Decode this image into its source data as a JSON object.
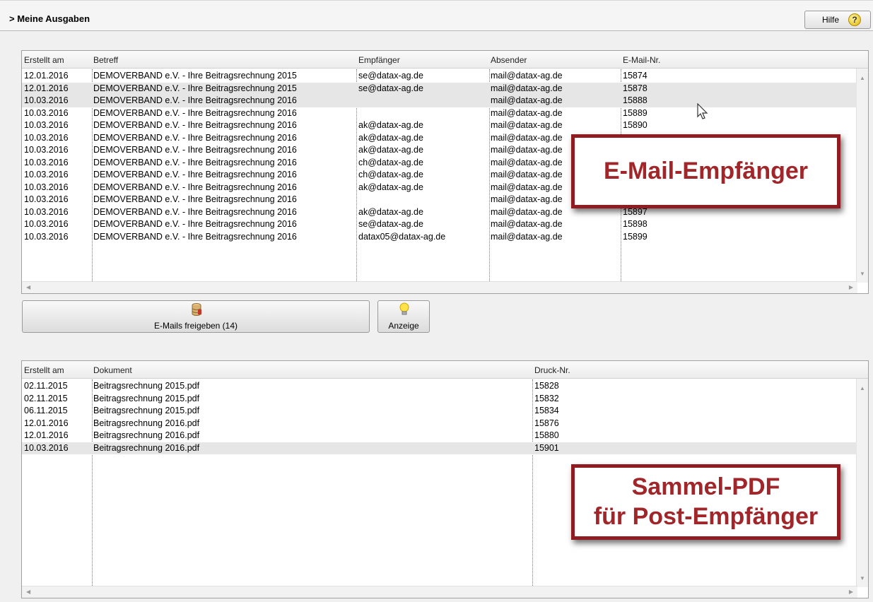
{
  "header": {
    "title": "> Meine Ausgaben",
    "help_label": "Hilfe",
    "help_icon": "question-icon"
  },
  "email_grid": {
    "columns": [
      "Erstellt am",
      "Betreff",
      "Empfänger",
      "Absender",
      "E-Mail-Nr."
    ],
    "rows": [
      [
        "12.01.2016",
        "DEMOVERBAND e.V. - Ihre Beitragsrechnung 2015",
        "se@datax-ag.de",
        "mail@datax-ag.de",
        "15874"
      ],
      [
        "12.01.2016",
        "DEMOVERBAND e.V. - Ihre Beitragsrechnung 2015",
        "se@datax-ag.de",
        "mail@datax-ag.de",
        "15878"
      ],
      [
        "10.03.2016",
        "DEMOVERBAND e.V. - Ihre Beitragsrechnung 2016",
        "",
        "mail@datax-ag.de",
        "15888"
      ],
      [
        "10.03.2016",
        "DEMOVERBAND e.V. - Ihre Beitragsrechnung 2016",
        "",
        "mail@datax-ag.de",
        "15889"
      ],
      [
        "10.03.2016",
        "DEMOVERBAND e.V. - Ihre Beitragsrechnung 2016",
        "ak@datax-ag.de",
        "mail@datax-ag.de",
        "15890"
      ],
      [
        "10.03.2016",
        "DEMOVERBAND e.V. - Ihre Beitragsrechnung 2016",
        "ak@datax-ag.de",
        "mail@datax-ag.de",
        ""
      ],
      [
        "10.03.2016",
        "DEMOVERBAND e.V. - Ihre Beitragsrechnung 2016",
        "ak@datax-ag.de",
        "mail@datax-ag.de",
        ""
      ],
      [
        "10.03.2016",
        "DEMOVERBAND e.V. - Ihre Beitragsrechnung 2016",
        "ch@datax-ag.de",
        "mail@datax-ag.de",
        ""
      ],
      [
        "10.03.2016",
        "DEMOVERBAND e.V. - Ihre Beitragsrechnung 2016",
        "ch@datax-ag.de",
        "mail@datax-ag.de",
        ""
      ],
      [
        "10.03.2016",
        "DEMOVERBAND e.V. - Ihre Beitragsrechnung 2016",
        "ak@datax-ag.de",
        "mail@datax-ag.de",
        ""
      ],
      [
        "10.03.2016",
        "DEMOVERBAND e.V. - Ihre Beitragsrechnung 2016",
        "",
        "mail@datax-ag.de",
        ""
      ],
      [
        "10.03.2016",
        "DEMOVERBAND e.V. - Ihre Beitragsrechnung 2016",
        "ak@datax-ag.de",
        "mail@datax-ag.de",
        "15897"
      ],
      [
        "10.03.2016",
        "DEMOVERBAND e.V. - Ihre Beitragsrechnung 2016",
        "se@datax-ag.de",
        "mail@datax-ag.de",
        "15898"
      ],
      [
        "10.03.2016",
        "DEMOVERBAND e.V. - Ihre Beitragsrechnung 2016",
        "datax05@datax-ag.de",
        "mail@datax-ag.de",
        "15899"
      ]
    ],
    "selected_rows": [
      1,
      2
    ]
  },
  "buttons": {
    "release_label": "E-Mails freigeben (14)",
    "release_icon": "database-icon",
    "show_label": "Anzeige",
    "show_icon": "lightbulb-icon"
  },
  "print_grid": {
    "columns": [
      "Erstellt am",
      "Dokument",
      "Druck-Nr."
    ],
    "rows": [
      [
        "02.11.2015",
        "Beitragsrechnung 2015.pdf",
        "15828"
      ],
      [
        "02.11.2015",
        "Beitragsrechnung 2015.pdf",
        "15832"
      ],
      [
        "06.11.2015",
        "Beitragsrechnung 2015.pdf",
        "15834"
      ],
      [
        "12.01.2016",
        "Beitragsrechnung 2016.pdf",
        "15876"
      ],
      [
        "12.01.2016",
        "Beitragsrechnung 2016.pdf",
        "15880"
      ],
      [
        "10.03.2016",
        "Beitragsrechnung 2016.pdf",
        "15901"
      ]
    ],
    "selected_rows": [
      5
    ]
  },
  "callouts": {
    "email": "E-Mail-Empfänger",
    "pdf_line1": "Sammel-PDF",
    "pdf_line2": "für Post-Empfänger"
  },
  "colors": {
    "callout_border": "#8f1c20",
    "callout_text": "#a0262a"
  }
}
